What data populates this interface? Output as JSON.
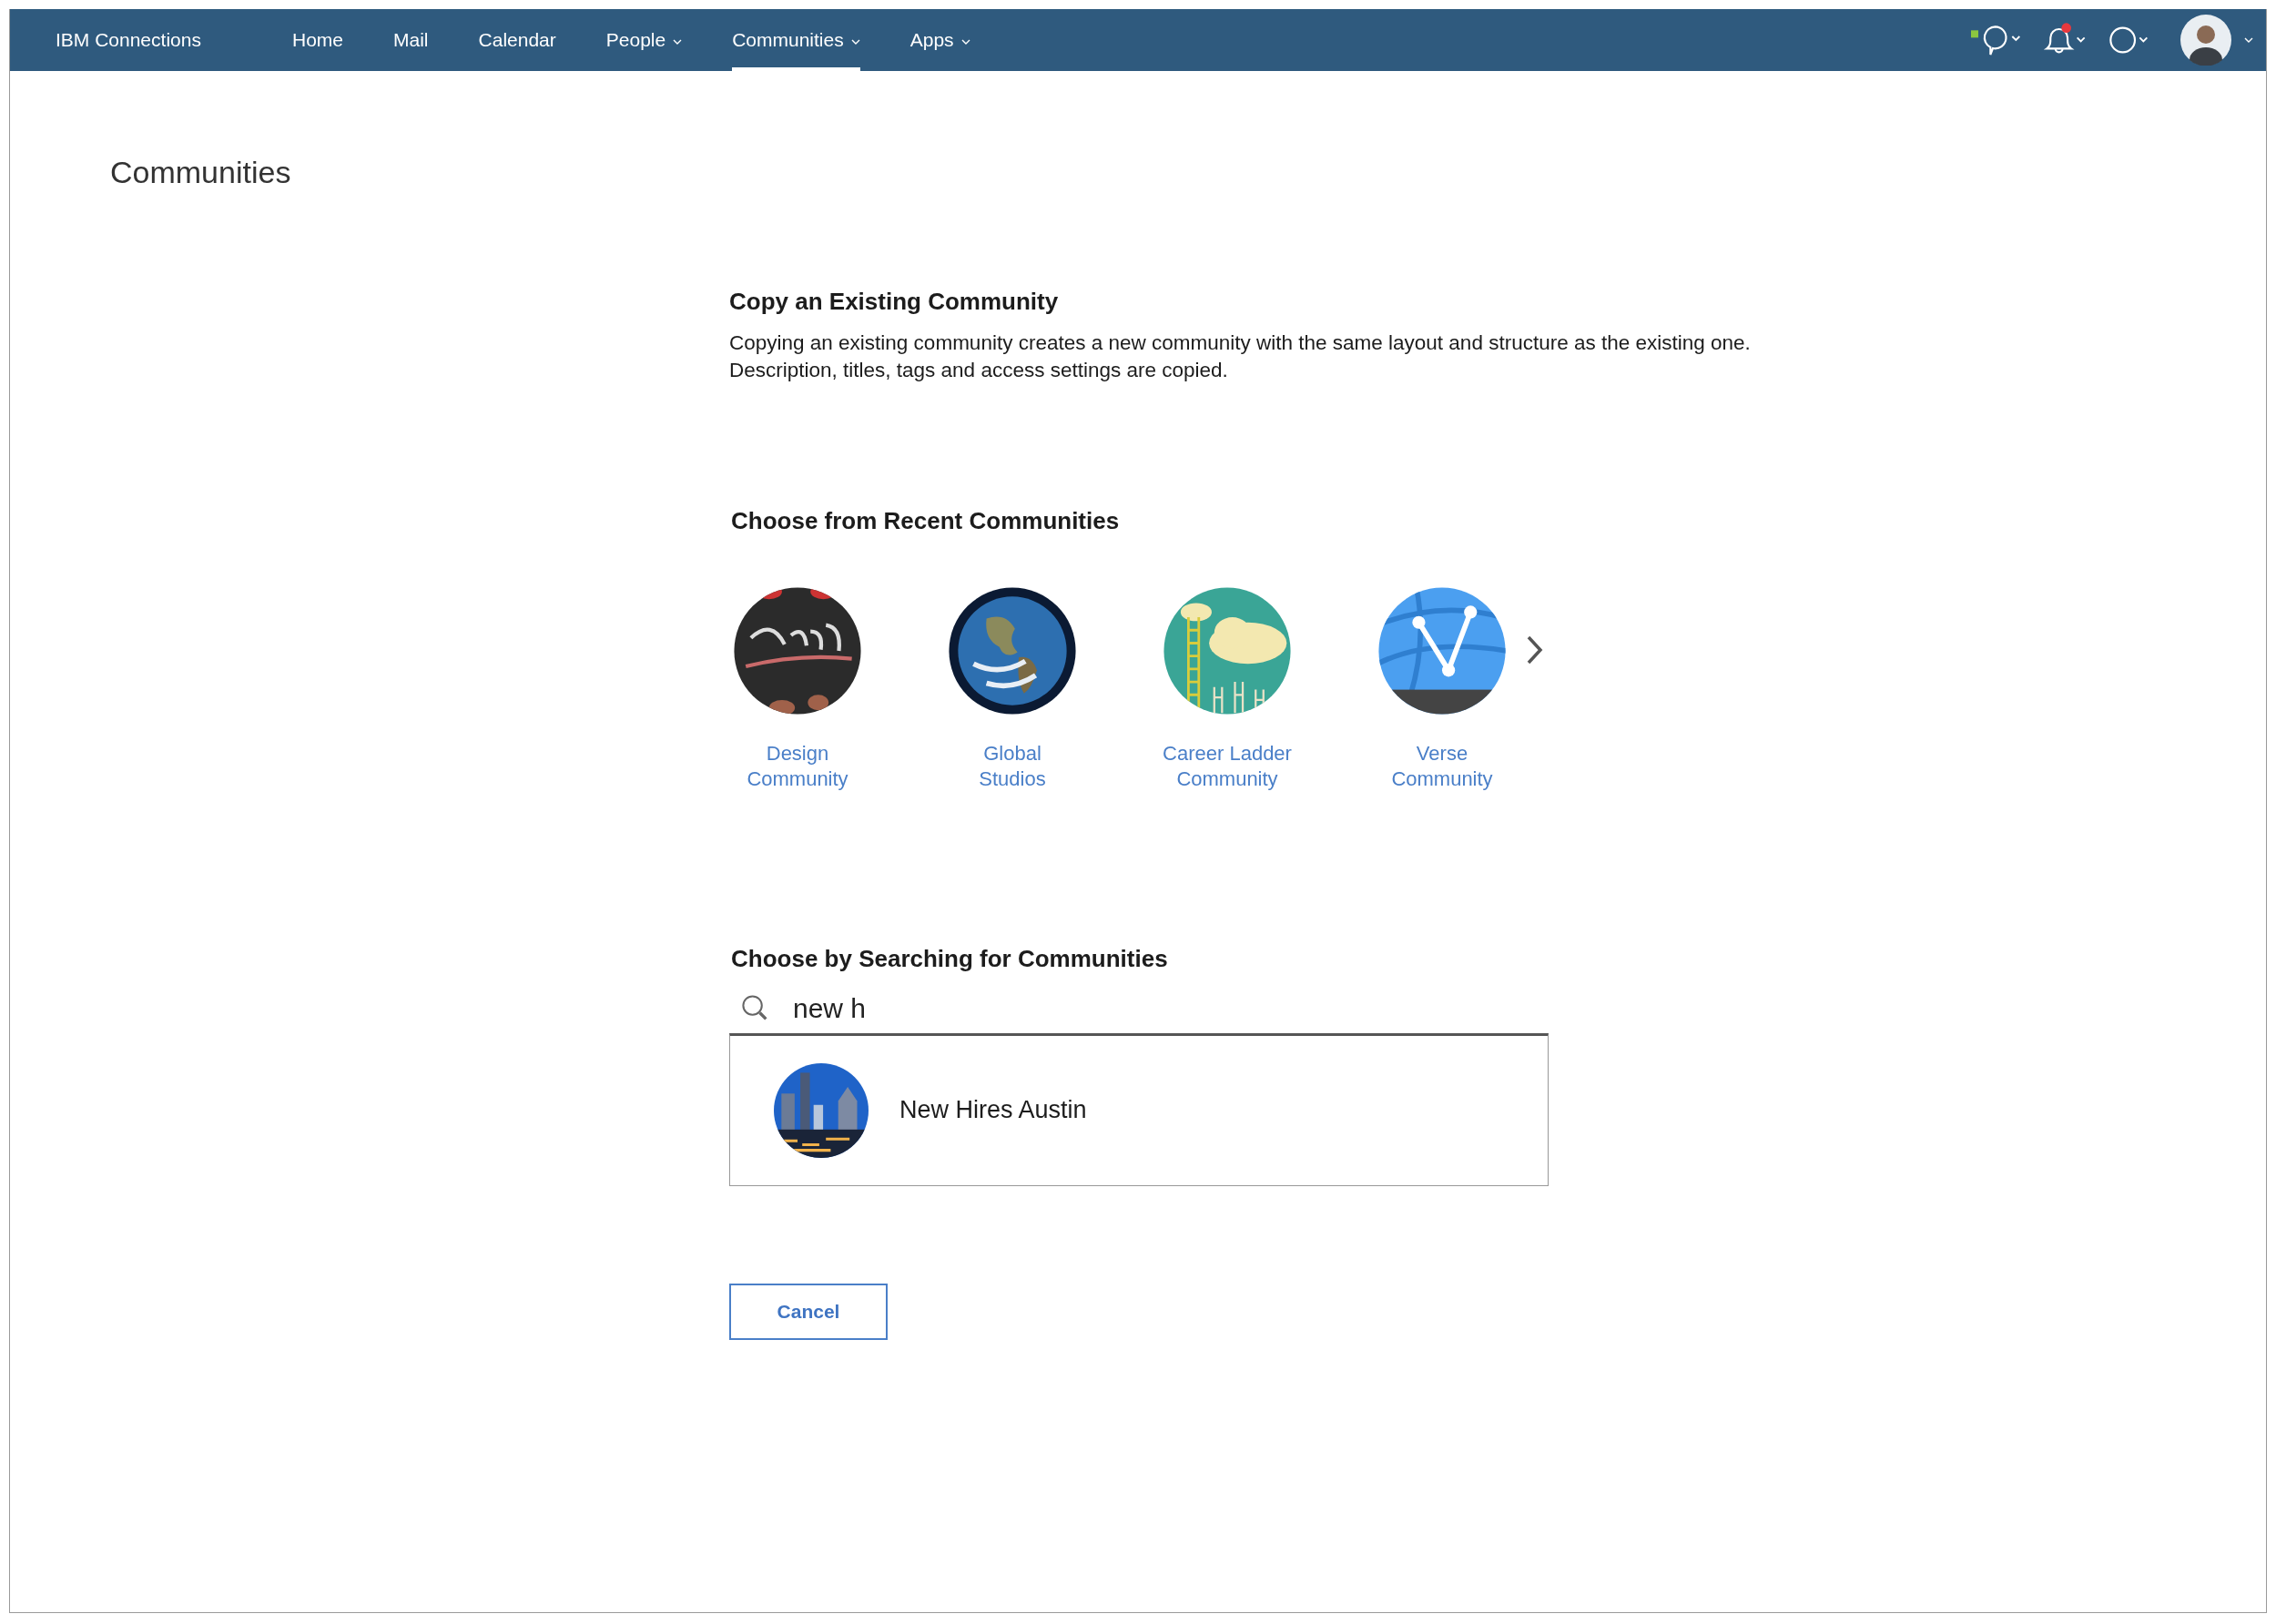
{
  "nav": {
    "brand": "IBM Connections",
    "items": [
      {
        "label": "Home",
        "selected": false,
        "dropdown": false
      },
      {
        "label": "Mail",
        "selected": false,
        "dropdown": false
      },
      {
        "label": "Calendar",
        "selected": false,
        "dropdown": false
      },
      {
        "label": "People",
        "selected": false,
        "dropdown": true
      },
      {
        "label": "Communities",
        "selected": true,
        "dropdown": true
      },
      {
        "label": "Apps",
        "selected": false,
        "dropdown": true
      }
    ],
    "notifications": {
      "unread": true
    }
  },
  "page_title": "Communities",
  "copy_section": {
    "heading": "Copy an Existing Community",
    "lines": [
      "Copying an existing community creates a new community with the same layout and structure as the existing one.",
      "Description, titles, tags and access settings are copied."
    ]
  },
  "recent": {
    "heading": "Choose from Recent Communities",
    "communities": [
      {
        "name": [
          "Design",
          "Community"
        ],
        "kind": "design"
      },
      {
        "name": [
          "Global",
          "Studios"
        ],
        "kind": "globe"
      },
      {
        "name": [
          "Career Ladder",
          "Community"
        ],
        "kind": "ladder"
      },
      {
        "name": [
          "Verse",
          "Community"
        ],
        "kind": "network"
      }
    ]
  },
  "search": {
    "heading": "Choose by Searching for Communities",
    "value": "new h",
    "results": [
      {
        "name": "New Hires Austin",
        "kind": "city"
      }
    ]
  },
  "cancel_button": "Cancel"
}
